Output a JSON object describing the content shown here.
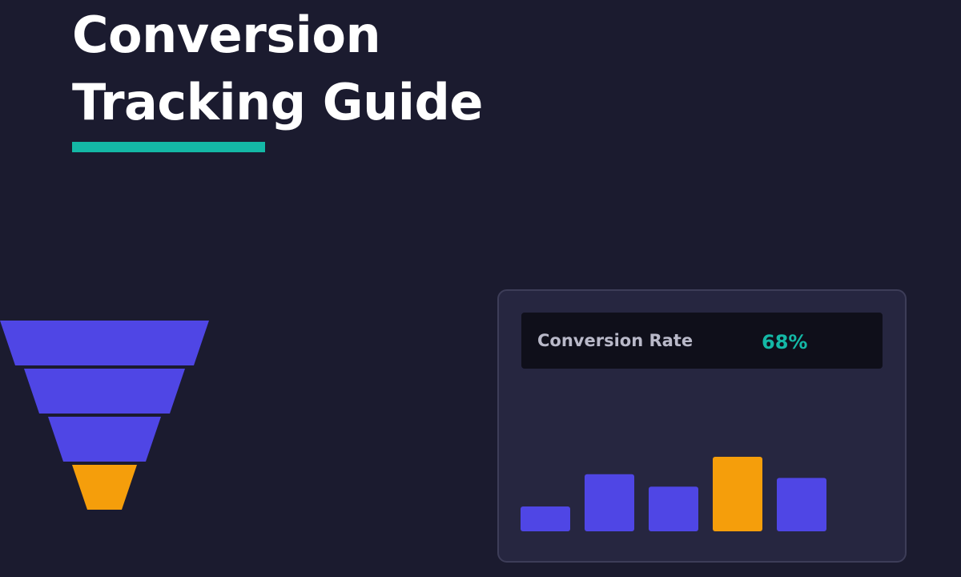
{
  "title": {
    "line1": "Conversion",
    "line2": "Tracking Guide"
  },
  "colors": {
    "background": "#1b1b2f",
    "accent_teal": "#14b8a6",
    "primary_indigo": "#4f46e5",
    "highlight_amber": "#f59e0b",
    "card_background": "#262640",
    "metric_background": "#0f0f1a"
  },
  "funnel": {
    "stages": [
      {
        "color": "#4f46e5"
      },
      {
        "color": "#4f46e5"
      },
      {
        "color": "#4f46e5"
      },
      {
        "color": "#f59e0b"
      }
    ]
  },
  "card": {
    "metric_label": "Conversion Rate",
    "metric_value": "68%"
  },
  "chart_data": {
    "type": "bar",
    "values": [
      2,
      4.6,
      3.6,
      6,
      4.3
    ],
    "highlight_index": 3,
    "colors": [
      "#4f46e5",
      "#4f46e5",
      "#4f46e5",
      "#f59e0b",
      "#4f46e5"
    ],
    "ylim": [
      0,
      6
    ]
  }
}
